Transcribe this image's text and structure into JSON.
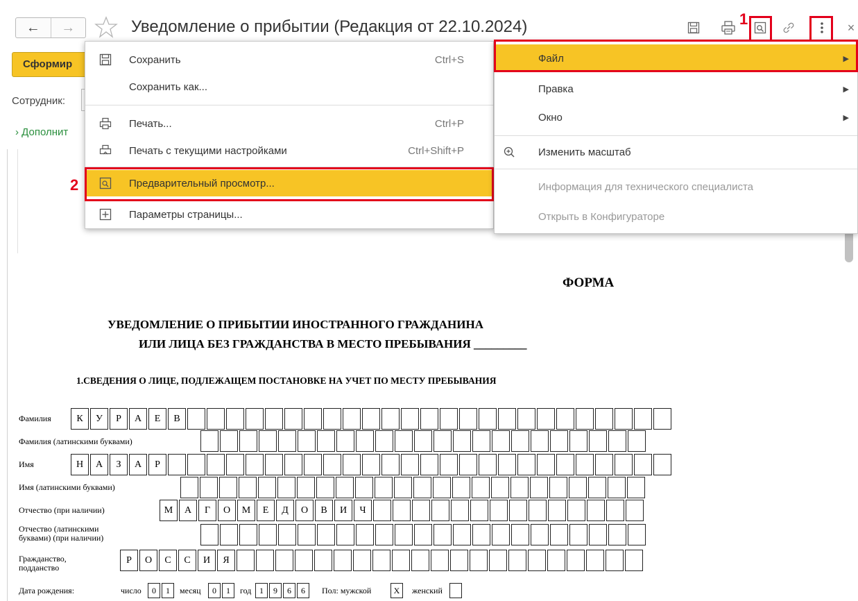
{
  "window": {
    "title": "Уведомление о прибытии (Редакция от 22.10.2024)",
    "back_icon": "←",
    "forward_icon": "→",
    "close_icon": "×",
    "marker1": "1",
    "marker2": "2"
  },
  "form": {
    "generate_button": "Сформир",
    "employee_label": "Сотрудник:",
    "additional_link": "Дополнит"
  },
  "document": {
    "forma": "ФОРМА",
    "heading1": "УВЕДОМЛЕНИЕ О ПРИБЫТИИ ИНОСТРАННОГО ГРАЖДАНИНА",
    "heading2": "ИЛИ ЛИЦА БЕЗ ГРАЖДАНСТВА В МЕСТО ПРЕБЫВАНИЯ _________",
    "section1": "1.СВЕДЕНИЯ О ЛИЦЕ, ПОДЛЕЖАЩЕМ ПОСТАНОВКЕ НА УЧЕТ ПО МЕСТУ ПРЕБЫВАНИЯ",
    "fields": {
      "surname": {
        "label": "Фамилия",
        "letters": [
          "К",
          "У",
          "Р",
          "А",
          "Е",
          "В"
        ]
      },
      "surname_lat": {
        "label": "Фамилия (латинскими буквами)",
        "letters": []
      },
      "name": {
        "label": "Имя",
        "letters": [
          "Н",
          "А",
          "З",
          "А",
          "Р"
        ]
      },
      "name_lat": {
        "label": "Имя (латинскими буквами)",
        "letters": []
      },
      "patronymic": {
        "label": "Отчество (при наличии)",
        "letters": [
          "М",
          "А",
          "Г",
          "О",
          "М",
          "Е",
          "Д",
          "О",
          "В",
          "И",
          "Ч"
        ]
      },
      "patronymic_lat": {
        "label1": "Отчество (латинскими",
        "label2": "буквами) (при наличии)",
        "letters": []
      },
      "citizenship": {
        "label1": "Гражданство,",
        "label2": "подданство",
        "letters": [
          "Р",
          "О",
          "С",
          "С",
          "И",
          "Я"
        ]
      },
      "birth": {
        "label": "Дата рождения:",
        "day_label": "число",
        "day": [
          "0",
          "1"
        ],
        "month_label": "месяц",
        "month": [
          "0",
          "1"
        ],
        "year_label": "год",
        "year": [
          "1",
          "9",
          "6",
          "6"
        ],
        "sex_label": "Пол: мужской",
        "male": "X",
        "female_label": "женский",
        "female": ""
      }
    }
  },
  "file_menu": {
    "items": [
      {
        "label": "Сохранить",
        "shortcut": "Ctrl+S",
        "icon": "save-icon"
      },
      {
        "label": "Сохранить как...",
        "shortcut": "",
        "icon": ""
      },
      {
        "label": "Печать...",
        "shortcut": "Ctrl+P",
        "icon": "print-icon"
      },
      {
        "label": "Печать с текущими настройками",
        "shortcut": "Ctrl+Shift+P",
        "icon": "print-settings-icon"
      },
      {
        "label": "Предварительный просмотр...",
        "shortcut": "",
        "icon": "preview-icon",
        "highlighted": true
      },
      {
        "label": "Параметры страницы...",
        "shortcut": "",
        "icon": "page-setup-icon"
      }
    ]
  },
  "main_menu": {
    "items": [
      {
        "label": "Файл",
        "submenu": true,
        "highlighted": true
      },
      {
        "label": "Правка",
        "submenu": true
      },
      {
        "label": "Окно",
        "submenu": true
      },
      {
        "label": "Изменить масштаб",
        "icon": "zoom-icon"
      },
      {
        "label": "Информация для технического специалиста",
        "disabled": true
      },
      {
        "label": "Открыть в Конфигураторе",
        "disabled": true
      }
    ]
  },
  "colors": {
    "accent": "#f7c425",
    "highlight_box": "#e3001b",
    "link_green": "#2a8f3d"
  }
}
